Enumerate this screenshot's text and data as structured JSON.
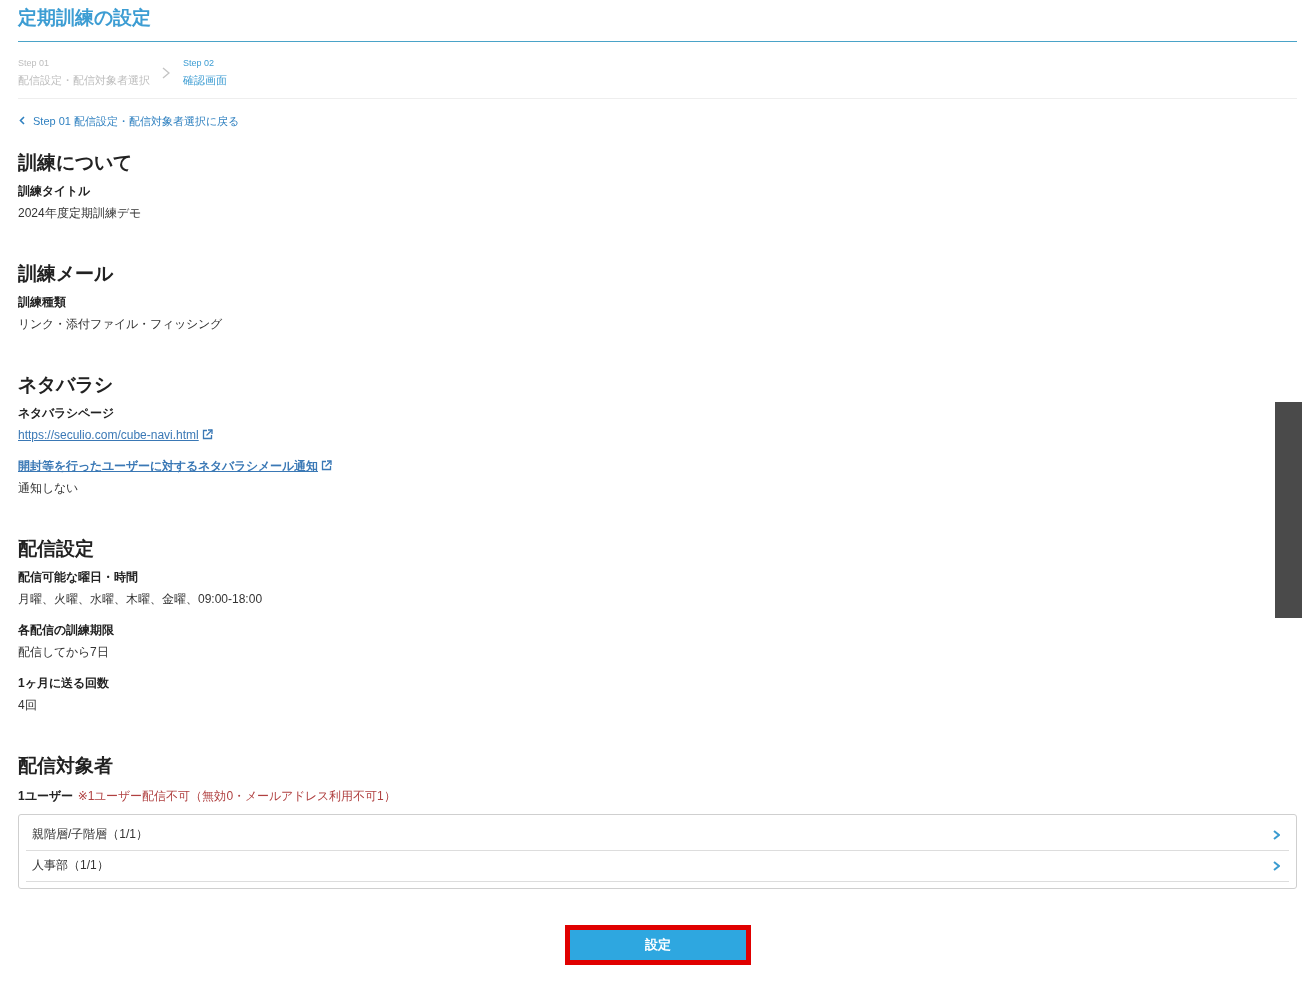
{
  "page": {
    "title": "定期訓練の設定"
  },
  "steps": [
    {
      "number": "Step 01",
      "label": "配信設定・配信対象者選択",
      "selected": false
    },
    {
      "number": "Step 02",
      "label": "確認画面",
      "selected": true
    }
  ],
  "back_link": {
    "label": "Step 01 配信設定・配信対象者選択に戻る"
  },
  "sections": [
    {
      "heading": "訓練について",
      "fields": [
        {
          "label": "訓練タイトル",
          "label_link": false,
          "value": "2024年度定期訓練デモ",
          "value_link": false
        }
      ]
    },
    {
      "heading": "訓練メール",
      "fields": [
        {
          "label": "訓練種類",
          "label_link": false,
          "value": "リンク・添付ファイル・フィッシング",
          "value_link": false
        }
      ]
    },
    {
      "heading": "ネタバラシ",
      "fields": [
        {
          "label": "ネタバラシページ",
          "label_link": false,
          "value": "https://seculio.com/cube-navi.html",
          "value_link": true
        },
        {
          "label": "開封等を行ったユーザーに対するネタバラシメール通知",
          "label_link": true,
          "value": "通知しない",
          "value_link": false
        }
      ]
    },
    {
      "heading": "配信設定",
      "fields": [
        {
          "label": "配信可能な曜日・時間",
          "label_link": false,
          "value": "月曜、火曜、水曜、木曜、金曜、09:00-18:00",
          "value_link": false
        },
        {
          "label": "各配信の訓練期限",
          "label_link": false,
          "value": "配信してから7日",
          "value_link": false
        },
        {
          "label": "1ヶ月に送る回数",
          "label_link": false,
          "value": "4回",
          "value_link": false
        }
      ]
    }
  ],
  "targets": {
    "heading": "配信対象者",
    "count": "1ユーザー",
    "note": "※1ユーザー配信不可（無効0・メールアドレス利用不可1）",
    "groups": [
      {
        "label": "親階層/子階層（1/1）"
      },
      {
        "label": "人事部（1/1）"
      }
    ]
  },
  "submit_button": {
    "label": "設定",
    "highlighted": true
  }
}
